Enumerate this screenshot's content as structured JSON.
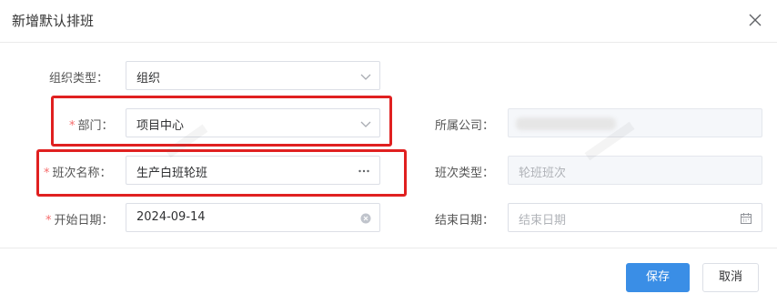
{
  "dialog": {
    "title": "新增默认排班",
    "close_icon": "close-icon"
  },
  "form": {
    "org_type": {
      "label": "组织类型：",
      "value": "组织",
      "icon": "chevron-down-icon"
    },
    "department": {
      "required_mark": "*",
      "label": "部门：",
      "value": "项目中心",
      "icon": "chevron-down-icon"
    },
    "company": {
      "label": "所属公司："
    },
    "shift_name": {
      "required_mark": "*",
      "label": "班次名称：",
      "value": "生产白班轮班",
      "icon": "more-icon"
    },
    "shift_type": {
      "label": "班次类型：",
      "value": "轮班班次"
    },
    "start_date": {
      "required_mark": "*",
      "label": "开始日期：",
      "value": "2024-09-14",
      "icon": "clear-icon"
    },
    "end_date": {
      "label": "结束日期：",
      "placeholder": "结束日期",
      "icon": "calendar-icon"
    }
  },
  "footer": {
    "save_label": "保存",
    "cancel_label": "取消"
  },
  "colors": {
    "primary": "#3a8ee6",
    "required": "#f56c6c",
    "highlight": "#e02020"
  }
}
